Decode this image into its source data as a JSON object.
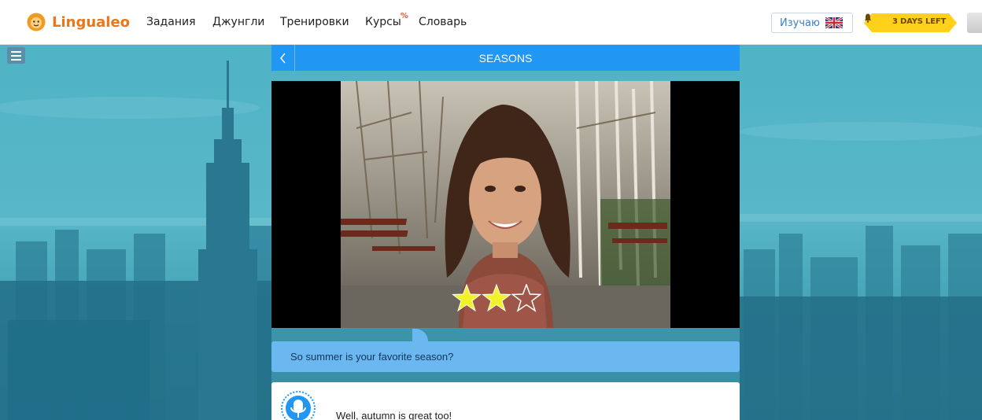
{
  "nav": {
    "brand": "Lingualeo",
    "items": [
      "Задания",
      "Джунгли",
      "Тренировки",
      "Курсы",
      "Словарь"
    ],
    "courses_badge": "%"
  },
  "header": {
    "studying_label": "Изучаю",
    "studying_flag": "uk-flag-icon",
    "days_left": "3 DAYS LEFT"
  },
  "lesson": {
    "back_icon": "chevron-left-icon",
    "title": "SEASONS",
    "rating": {
      "filled": 2,
      "total": 3
    },
    "question": "So summer is your favorite season?",
    "answer": "Well, autumn is great too!"
  },
  "colors": {
    "accent": "#2196f3",
    "bubble": "#6ab8ef",
    "brand": "#e8761b",
    "badge": "#ffd11a",
    "star": "#f2f22a"
  }
}
